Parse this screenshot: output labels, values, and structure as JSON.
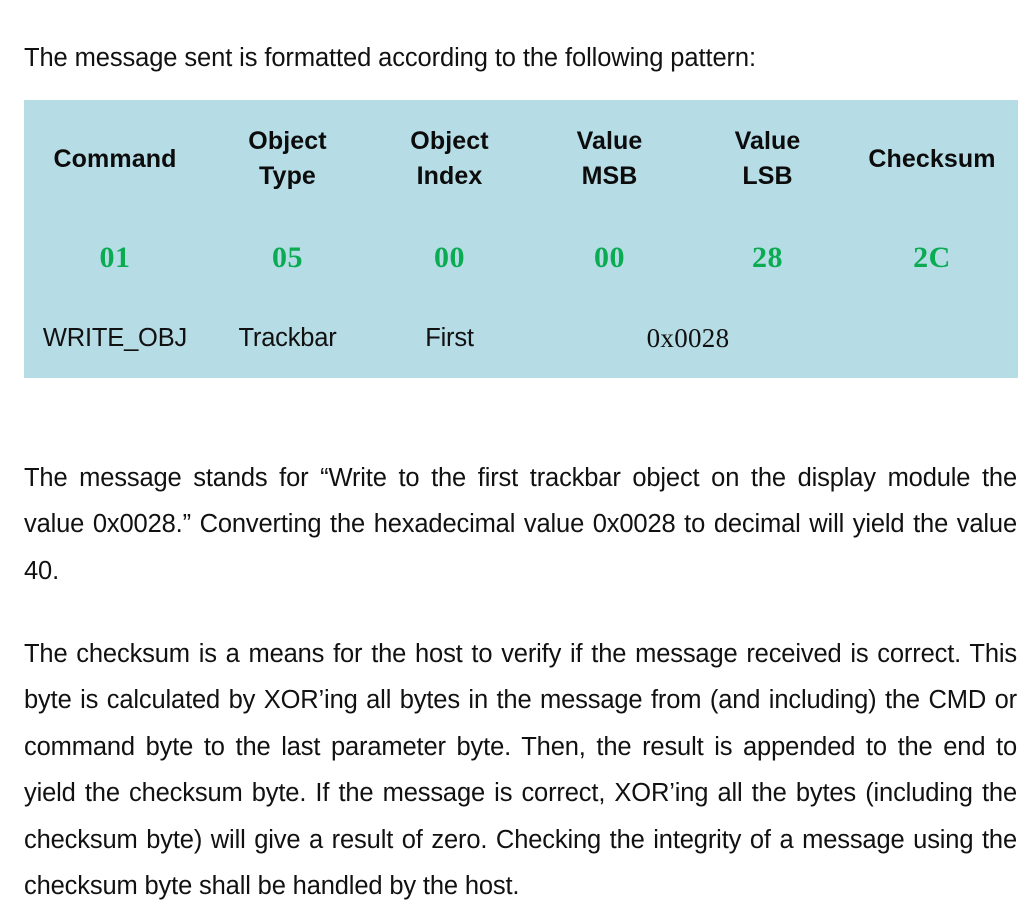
{
  "document": {
    "intro": "The message sent is formatted according to the following pattern:",
    "table": {
      "background_color": "#b6dce6",
      "hex_value_color": "#0bab52",
      "headers": [
        {
          "line1": "Command",
          "line2": ""
        },
        {
          "line1": "Object",
          "line2": "Type"
        },
        {
          "line1": "Object",
          "line2": "Index"
        },
        {
          "line1": "Value",
          "line2": "MSB"
        },
        {
          "line1": "Value",
          "line2": "LSB"
        },
        {
          "line1": "Checksum",
          "line2": ""
        }
      ],
      "hex_values": [
        "01",
        "05",
        "00",
        "00",
        "28",
        "2C"
      ],
      "meanings": {
        "command": "WRITE_OBJ",
        "object_type": "Trackbar",
        "object_index": "First",
        "value": "0x0028"
      }
    },
    "paragraphs": [
      "The message stands for “Write to the first trackbar object on the display module the value 0x0028.” Converting the hexadecimal value 0x0028 to decimal will yield the value 40.",
      "The checksum is a means for the host to verify if the message received is correct. This byte is calculated by XOR’ing all bytes in the message from (and including) the CMD or command byte to the last parameter byte. Then, the result is appended to the end to yield the checksum byte. If the message is correct, XOR’ing all the bytes (including the checksum byte) will give a result of zero. Checking the integrity of a message using the checksum byte shall be handled by the host."
    ]
  }
}
